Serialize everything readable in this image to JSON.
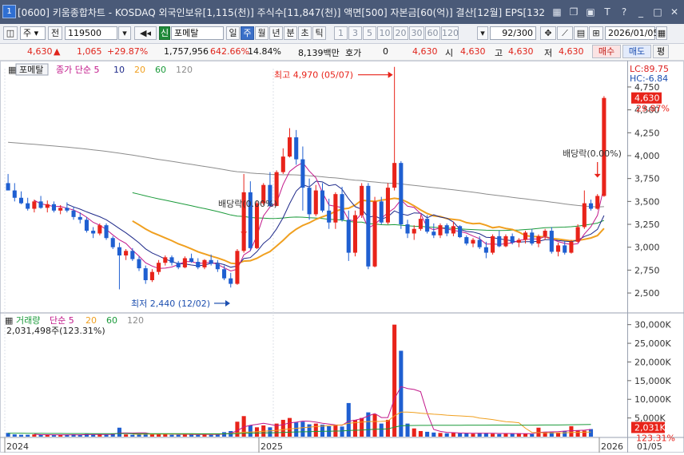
{
  "window": {
    "number": "1",
    "title": "[0600] 키움종합차트 - KOSDAQ 외국인보유[1,115(천)] 주식수[11,847(천)] 액면[500] 자본금[60(억)] 결산[12월] EPS[132"
  },
  "toolbar": {
    "mode": "주",
    "all_label": "전",
    "code": "119500",
    "stock_badge": "신",
    "stock_name": "포메탈",
    "period_tabs": [
      "일",
      "주",
      "월",
      "년",
      "분",
      "초",
      "틱"
    ],
    "selected_period": "주",
    "intervals": [
      "1",
      "3",
      "5",
      "10",
      "20",
      "30",
      "60",
      "120"
    ],
    "count": "92/300",
    "date": "2026/01/05"
  },
  "price": {
    "current": "4,630",
    "arrow": "▲",
    "change": "1,065",
    "change_pct": "+29.87%",
    "volume": "1,757,956",
    "volume_pct": "642.66%",
    "turnover": "14.84%",
    "amount": "8,139백만",
    "bid_label": "호가",
    "bid_value": "0",
    "ask": "4,630",
    "open_label": "시",
    "open": "4,630",
    "high_label": "고",
    "high": "4,630",
    "low_label": "저",
    "low": "4,630",
    "buy_label": "매수",
    "sell_label": "매도",
    "flat_label": "평"
  },
  "price_panel": {
    "name_tag": "포메탈",
    "legend_prefix": "종가 단순",
    "ma_labels": [
      "5",
      "10",
      "20",
      "60",
      "120"
    ],
    "lc": "LC:89.75",
    "hc": "HC:-6.84",
    "last_price_tag": "4,630",
    "last_pct_tag": "29.87%",
    "high_label": "최고 4,970 (05/07)",
    "low_label": "최저 2,440 (12/02)",
    "dividend_label_1": "배당락(0.00%)",
    "dividend_label_2": "배당락(0.00%)",
    "y_ticks": [
      "4,750",
      "4,500",
      "4,250",
      "4,000",
      "3,750",
      "3,500",
      "3,250",
      "3,000",
      "2,750",
      "2,500"
    ]
  },
  "volume_panel": {
    "title": "거래량",
    "legend_prefix": "단순",
    "ma_labels": [
      "5",
      "20",
      "60",
      "120"
    ],
    "current_volume": "2,031,498주(123.31%)",
    "last_tag": "2,031K",
    "last_pct_tag": "123.31%",
    "y_ticks": [
      "30,000K",
      "25,000K",
      "20,000K",
      "15,000K",
      "10,000K",
      "5,000K"
    ]
  },
  "x_axis": {
    "labels": [
      "2024",
      "2025",
      "2026",
      "01/05"
    ]
  },
  "colors": {
    "up": "#e8231a",
    "down": "#1f5fd1",
    "ma5": "#c2188a",
    "ma10": "#1f2a8a",
    "ma20": "#f0a020",
    "ma60": "#1a9a3a",
    "ma120": "#8c8c8c"
  },
  "chart_data": {
    "type": "candlestick",
    "interval": "weekly",
    "x_range": [
      "2024-01",
      "2026-01-05"
    ],
    "ylim": [
      2300,
      4950
    ],
    "volume_ylim": [
      0,
      31000
    ],
    "candles_ohlc": [
      [
        3700,
        3800,
        3650,
        3620
      ],
      [
        3620,
        3700,
        3500,
        3540
      ],
      [
        3540,
        3610,
        3470,
        3480
      ],
      [
        3480,
        3540,
        3400,
        3420
      ],
      [
        3420,
        3520,
        3380,
        3500
      ],
      [
        3500,
        3560,
        3420,
        3430
      ],
      [
        3430,
        3510,
        3380,
        3470
      ],
      [
        3470,
        3500,
        3380,
        3400
      ],
      [
        3400,
        3460,
        3360,
        3430
      ],
      [
        3430,
        3490,
        3380,
        3400
      ],
      [
        3400,
        3440,
        3300,
        3330
      ],
      [
        3330,
        3380,
        3260,
        3300
      ],
      [
        3300,
        3330,
        3160,
        3180
      ],
      [
        3180,
        3220,
        3100,
        3150
      ],
      [
        3150,
        3260,
        3130,
        3240
      ],
      [
        3240,
        3260,
        3080,
        3100
      ],
      [
        3100,
        3120,
        2980,
        3000
      ],
      [
        3000,
        3050,
        2540,
        2910
      ],
      [
        2910,
        2980,
        2860,
        2960
      ],
      [
        2960,
        2990,
        2850,
        2870
      ],
      [
        2870,
        2900,
        2740,
        2770
      ],
      [
        2770,
        2800,
        2600,
        2640
      ],
      [
        2640,
        2760,
        2620,
        2730
      ],
      [
        2730,
        2860,
        2700,
        2830
      ],
      [
        2830,
        2910,
        2800,
        2890
      ],
      [
        2890,
        2910,
        2800,
        2830
      ],
      [
        2830,
        2850,
        2760,
        2780
      ],
      [
        2780,
        2900,
        2770,
        2880
      ],
      [
        2880,
        2930,
        2830,
        2840
      ],
      [
        2840,
        2880,
        2760,
        2780
      ],
      [
        2780,
        2870,
        2760,
        2860
      ],
      [
        2860,
        2920,
        2800,
        2820
      ],
      [
        2820,
        2860,
        2730,
        2760
      ],
      [
        2760,
        2800,
        2640,
        2660
      ],
      [
        2660,
        2720,
        2560,
        2600
      ],
      [
        2600,
        2980,
        2590,
        2960
      ],
      [
        2960,
        3800,
        2940,
        3600
      ],
      [
        3600,
        3720,
        2960,
        2990
      ],
      [
        2990,
        3500,
        2980,
        3480
      ],
      [
        3480,
        3700,
        3460,
        3680
      ],
      [
        3680,
        3820,
        3440,
        3450
      ],
      [
        3450,
        3840,
        3450,
        3820
      ],
      [
        3820,
        4080,
        3800,
        3990
      ],
      [
        3990,
        4300,
        3980,
        4200
      ],
      [
        4200,
        4280,
        3900,
        3960
      ],
      [
        3960,
        4100,
        3400,
        3650
      ],
      [
        3650,
        3750,
        3300,
        3360
      ],
      [
        3360,
        3680,
        3340,
        3620
      ],
      [
        3620,
        3700,
        3380,
        3400
      ],
      [
        3400,
        3530,
        3200,
        3270
      ],
      [
        3270,
        3600,
        3200,
        3580
      ],
      [
        3580,
        3660,
        3280,
        3300
      ],
      [
        3300,
        3400,
        2850,
        2940
      ],
      [
        2940,
        3400,
        2900,
        3350
      ],
      [
        3350,
        3700,
        3320,
        3670
      ],
      [
        3670,
        3700,
        2760,
        2790
      ],
      [
        2790,
        3550,
        2780,
        3500
      ],
      [
        3500,
        3550,
        3250,
        3270
      ],
      [
        3270,
        3700,
        3250,
        3650
      ],
      [
        3650,
        4970,
        3620,
        3920
      ],
      [
        3920,
        3940,
        3200,
        3250
      ],
      [
        3250,
        3300,
        3100,
        3150
      ],
      [
        3150,
        3240,
        3080,
        3200
      ],
      [
        3200,
        3350,
        3180,
        3310
      ],
      [
        3310,
        3350,
        3150,
        3170
      ],
      [
        3170,
        3260,
        3100,
        3130
      ],
      [
        3130,
        3260,
        3100,
        3240
      ],
      [
        3240,
        3260,
        3120,
        3150
      ],
      [
        3150,
        3280,
        3120,
        3230
      ],
      [
        3230,
        3240,
        3100,
        3110
      ],
      [
        3110,
        3130,
        3020,
        3040
      ],
      [
        3040,
        3100,
        3000,
        3080
      ],
      [
        3080,
        3120,
        2980,
        3000
      ],
      [
        3000,
        3060,
        2880,
        2940
      ],
      [
        2940,
        3140,
        2920,
        3120
      ],
      [
        3120,
        3180,
        3000,
        3010
      ],
      [
        3010,
        3140,
        3000,
        3120
      ],
      [
        3120,
        3150,
        3030,
        3050
      ],
      [
        3050,
        3100,
        3000,
        3080
      ],
      [
        3080,
        3180,
        3040,
        3160
      ],
      [
        3160,
        3200,
        3020,
        3040
      ],
      [
        3040,
        3140,
        3000,
        3120
      ],
      [
        3120,
        3200,
        3080,
        3180
      ],
      [
        3180,
        3220,
        2930,
        2950
      ],
      [
        2950,
        3050,
        2900,
        3020
      ],
      [
        3020,
        3070,
        2920,
        2940
      ],
      [
        2940,
        3080,
        2930,
        3060
      ],
      [
        3060,
        3250,
        3050,
        3220
      ],
      [
        3220,
        3620,
        3200,
        3480
      ],
      [
        3480,
        3520,
        3400,
        3420
      ],
      [
        3420,
        3580,
        3410,
        3560
      ],
      [
        3560,
        4650,
        3550,
        4630
      ]
    ],
    "volumes": [
      1000,
      600,
      500,
      500,
      600,
      500,
      450,
      400,
      450,
      500,
      600,
      550,
      700,
      500,
      600,
      500,
      800,
      2400,
      600,
      500,
      700,
      900,
      600,
      800,
      700,
      500,
      500,
      700,
      600,
      500,
      600,
      500,
      700,
      1200,
      1500,
      4000,
      5500,
      3000,
      2500,
      3000,
      2500,
      3500,
      4500,
      5000,
      3800,
      4000,
      3300,
      3500,
      3200,
      2800,
      3000,
      2700,
      9000,
      4500,
      5000,
      6500,
      6000,
      3500,
      4500,
      30000,
      23000,
      3500,
      2200,
      1500,
      1300,
      1100,
      1000,
      900,
      1000,
      900,
      900,
      800,
      1000,
      1000,
      800,
      700,
      800,
      900,
      900,
      800,
      700,
      2400,
      1300,
      1200,
      1100,
      1500,
      2800,
      1700,
      1600,
      2031
    ]
  }
}
